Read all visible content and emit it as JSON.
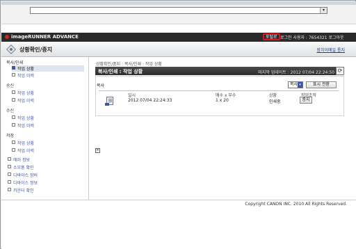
{
  "browser": {
    "address_value": ""
  },
  "header": {
    "brand": "imageRUNNER ADVANCE",
    "home_label": "포털로",
    "login_user": "로그인 사용자 : 7654321 로그아웃",
    "page_title": "상황확인/중지",
    "notify_link": "장치이메일 통지"
  },
  "sidebar": {
    "groups": [
      {
        "label": "복사/인쇄",
        "items": [
          "작업 상황",
          "작업 이력"
        ]
      },
      {
        "label": "송신",
        "items": [
          "작업 상황",
          "작업 이력"
        ]
      },
      {
        "label": "수신",
        "items": [
          "작업 상황",
          "작업 이력"
        ]
      },
      {
        "label": "저장",
        "items": [
          "작업 상황",
          "작업 이력"
        ]
      }
    ],
    "top_items": [
      "에러 정보",
      "소모품 확인",
      "디바이스 장비",
      "디바이스 정보",
      "카운터 확인"
    ]
  },
  "main": {
    "breadcrumb": "상황확인/중지 : 복사/인쇄 : 작업 상황",
    "section_title": "복사/인쇄 : 작업 상황",
    "updated": "마지막 업데이트 : 2012 07/04 22:24:50",
    "copy_label": "복사",
    "type_select_value": "복사",
    "toggle_label": "표시 전환",
    "columns": [
      "일시",
      "매수 x 부수",
      "상황",
      "작업조작"
    ],
    "job": {
      "datetime": "2012 07/04 22:24:33",
      "count": "1 x 20",
      "status": "인쇄중",
      "action_label": "중지"
    }
  },
  "footer": {
    "copyright": "Copyright CANON INC. 2010 All Rights Reserved."
  },
  "colors": {
    "accent": "#3f57a6",
    "highlight": "#e0141b",
    "header_bg": "#2a2a2a"
  },
  "icons": {
    "refresh": "refresh-icon",
    "job": "print-job-icon",
    "logo": "canon-logo"
  }
}
